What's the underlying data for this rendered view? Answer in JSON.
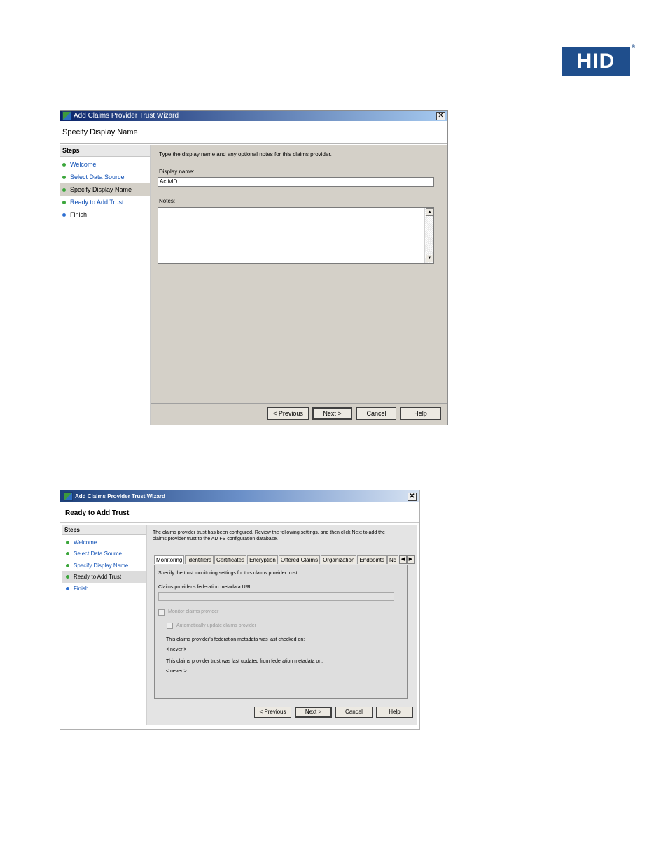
{
  "logo": {
    "text": "HID",
    "reg": "®",
    "color": "#1f4e8c"
  },
  "wizard1": {
    "title": "Add Claims Provider Trust Wizard",
    "close": "✕",
    "page_title": "Specify Display Name",
    "steps_title": "Steps",
    "steps": [
      {
        "label": "Welcome",
        "status": "done"
      },
      {
        "label": "Select Data Source",
        "status": "done"
      },
      {
        "label": "Specify Display Name",
        "status": "current"
      },
      {
        "label": "Ready to Add Trust",
        "status": "done"
      },
      {
        "label": "Finish",
        "status": "pending"
      }
    ],
    "instruction": "Type the display name and any optional notes for this claims provider.",
    "display_name_label": "Display name:",
    "display_name_value": "ActivID",
    "notes_label": "Notes:",
    "notes_value": "",
    "buttons": {
      "previous": "< Previous",
      "next": "Next >",
      "cancel": "Cancel",
      "help": "Help"
    }
  },
  "wizard2": {
    "title": "Add Claims Provider Trust Wizard",
    "close": "✕",
    "page_title": "Ready to Add Trust",
    "steps_title": "Steps",
    "steps": [
      {
        "label": "Welcome",
        "status": "done"
      },
      {
        "label": "Select Data Source",
        "status": "done"
      },
      {
        "label": "Specify Display Name",
        "status": "done"
      },
      {
        "label": "Ready to Add Trust",
        "status": "current"
      },
      {
        "label": "Finish",
        "status": "pending"
      }
    ],
    "instruction_line1": "The claims provider trust has been configured. Review the following settings, and then click Next to add the",
    "instruction_line2": "claims provider trust to the AD FS configuration database.",
    "tabs": [
      "Monitoring",
      "Identifiers",
      "Certificates",
      "Encryption",
      "Offered Claims",
      "Organization",
      "Endpoints",
      "Nc"
    ],
    "active_tab": "Monitoring",
    "monitoring_desc": "Specify the trust monitoring settings for this claims provider trust.",
    "metadata_url_label": "Claims provider's federation metadata URL:",
    "metadata_url_value": "",
    "monitor_label": "Monitor claims provider",
    "auto_update_label": "Automatically update claims provider",
    "last_checked_label": "This claims provider's federation metadata was last checked on:",
    "last_checked_value": "< never >",
    "last_updated_label": "This claims provider trust was last updated from federation metadata on:",
    "last_updated_value": "< never >",
    "buttons": {
      "previous": "< Previous",
      "next": "Next >",
      "cancel": "Cancel",
      "help": "Help"
    }
  },
  "colors": {
    "titlebar1": "#0a246a",
    "titlebar2": "#2c5aa0",
    "dialog_bg": "#d4d0c8",
    "link": "#0b4db4"
  }
}
